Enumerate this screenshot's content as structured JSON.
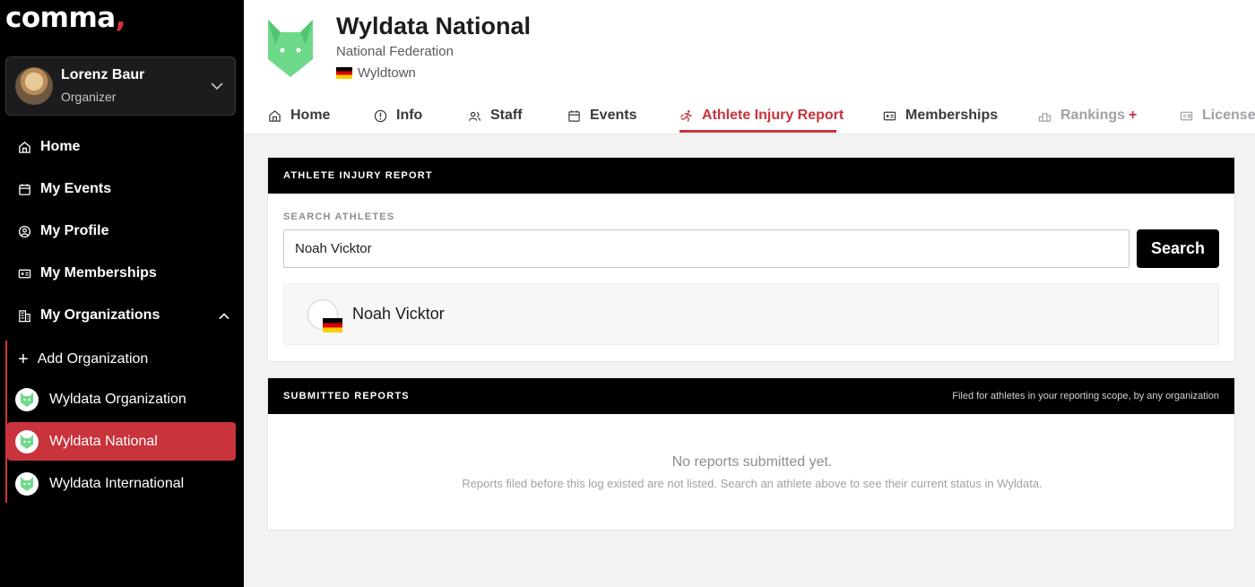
{
  "brand": {
    "logo_text": "comma",
    "logo_mark": ","
  },
  "user": {
    "name": "Lorenz Baur",
    "role": "Organizer"
  },
  "sidebar": {
    "items": [
      {
        "label": "Home",
        "icon": "home-icon"
      },
      {
        "label": "My Events",
        "icon": "calendar-icon"
      },
      {
        "label": "My Profile",
        "icon": "user-circle-icon"
      },
      {
        "label": "My Memberships",
        "icon": "id-card-icon"
      },
      {
        "label": "My Organizations",
        "icon": "building-icon"
      }
    ],
    "add_org": "Add Organization",
    "orgs": [
      {
        "label": "Wyldata Organization",
        "active": false
      },
      {
        "label": "Wyldata National",
        "active": true
      },
      {
        "label": "Wyldata International",
        "active": false
      }
    ]
  },
  "org": {
    "name": "Wyldata National",
    "type": "National Federation",
    "location": "Wyldtown"
  },
  "tabs": [
    {
      "label": "Home",
      "icon": "home-icon"
    },
    {
      "label": "Info",
      "icon": "info-icon"
    },
    {
      "label": "Staff",
      "icon": "users-icon"
    },
    {
      "label": "Events",
      "icon": "calendar-icon"
    },
    {
      "label": "Athlete Injury Report",
      "icon": "runner-icon",
      "active": true
    },
    {
      "label": "Memberships",
      "icon": "id-card-icon"
    },
    {
      "label": "Rankings",
      "icon": "podium-icon",
      "badge": "+"
    },
    {
      "label": "Licenses",
      "icon": "license-icon"
    }
  ],
  "injury_panel": {
    "title": "ATHLETE INJURY REPORT",
    "search_label": "SEARCH ATHLETES",
    "search_value": "Noah Vicktor",
    "search_button": "Search",
    "result_name": "Noah Vicktor"
  },
  "reports_panel": {
    "title": "SUBMITTED REPORTS",
    "note": "Filed for athletes in your reporting scope, by any organization",
    "empty_title": "No reports submitted yet.",
    "empty_sub": "Reports filed before this log existed are not listed. Search an athlete above to see their current status in Wyldata."
  },
  "colors": {
    "accent": "#c8333c",
    "sidebar_bg": "#000000",
    "logo_green": "#6fd98a"
  }
}
